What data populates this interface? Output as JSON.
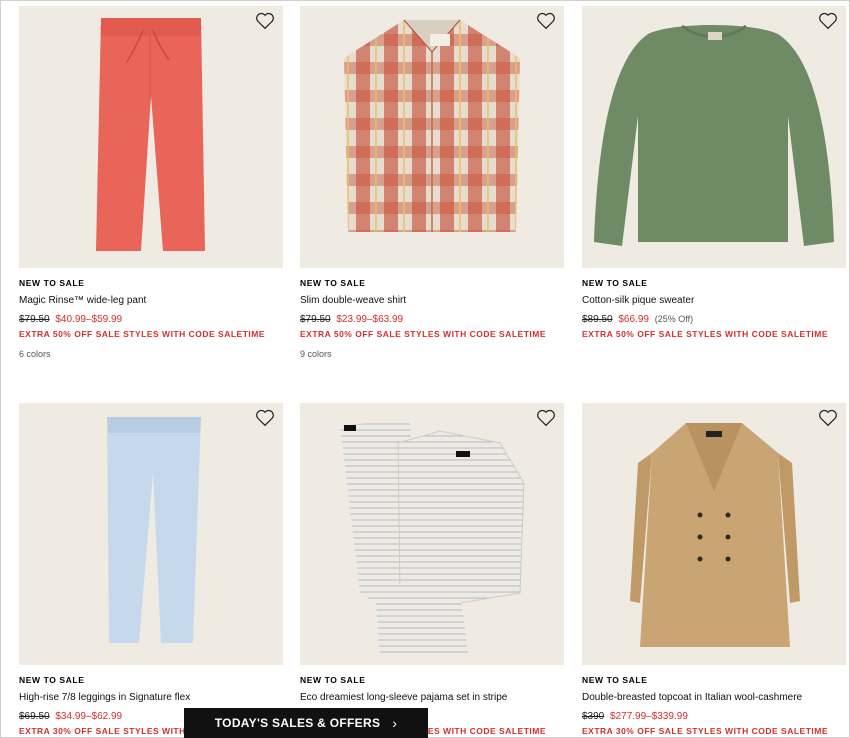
{
  "products": [
    {
      "badge": "NEW TO SALE",
      "name": "Magic Rinse™ wide-leg pant",
      "orig": "$79.50",
      "sale": "$40.99–$59.99",
      "pct": "",
      "promo": "EXTRA 50% OFF SALE STYLES WITH CODE SALETIME",
      "colors": "6 colors",
      "item_color": "#e9655a"
    },
    {
      "badge": "NEW TO SALE",
      "name": "Slim double-weave shirt",
      "orig": "$79.50",
      "sale": "$23.99–$63.99",
      "pct": "",
      "promo": "EXTRA 50% OFF SALE STYLES WITH CODE SALETIME",
      "colors": "9 colors",
      "item_color": "#c9553d"
    },
    {
      "badge": "NEW TO SALE",
      "name": "Cotton-silk pique sweater",
      "orig": "$89.50",
      "sale": "$66.99",
      "pct": "(25% Off)",
      "promo": "EXTRA 50% OFF SALE STYLES WITH CODE SALETIME",
      "colors": "",
      "item_color": "#6e8b66"
    },
    {
      "badge": "NEW TO SALE",
      "name": "High-rise 7/8 leggings in Signature flex",
      "orig": "$69.50",
      "sale": "$34.99–$62.99",
      "pct": "",
      "promo": "EXTRA 30% OFF SALE STYLES WITH CODE SALETIME",
      "colors": "",
      "item_color": "#c6d9ec"
    },
    {
      "badge": "NEW TO SALE",
      "name": "Eco dreamiest long-sleeve pajama set in stripe",
      "orig": "",
      "sale": "",
      "pct": "",
      "promo": "EXTRA 30% OFF SALE STYLES WITH CODE SALETIME",
      "colors": "",
      "item_color": "#e4e2dd"
    },
    {
      "badge": "NEW TO SALE",
      "name": "Double-breasted topcoat in Italian wool-cashmere",
      "orig": "$390",
      "sale": "$277.99–$339.99",
      "pct": "",
      "promo": "EXTRA 30% OFF SALE STYLES WITH CODE SALETIME",
      "colors": "",
      "item_color": "#c9a574"
    }
  ],
  "banner": {
    "label": "TODAY'S SALES & OFFERS",
    "chevron": "›"
  },
  "icons": {
    "favorite": "heart-icon"
  }
}
